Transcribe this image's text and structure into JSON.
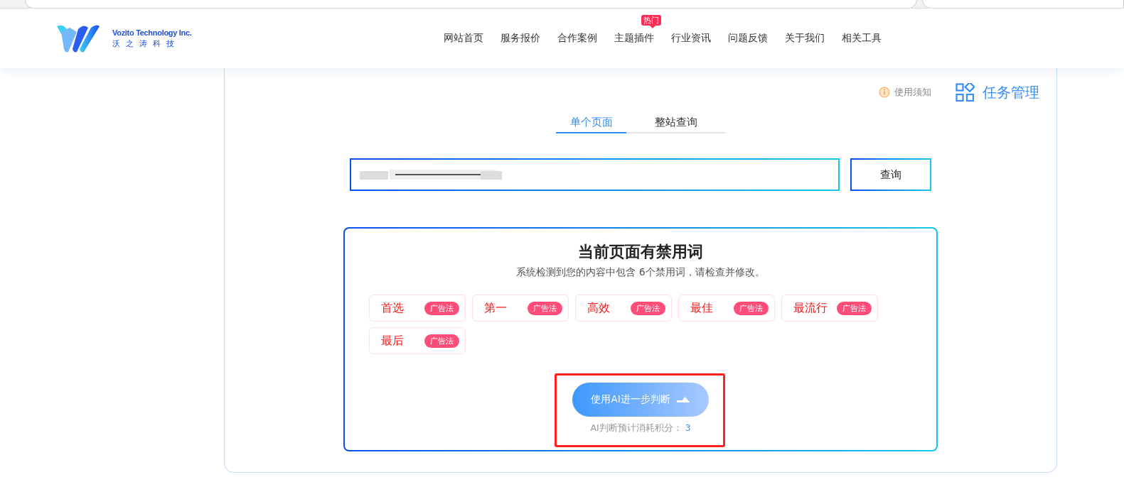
{
  "header": {
    "logo": {
      "name_en": "Vozito Technology Inc.",
      "name_cn": "沃之涛科技"
    },
    "nav": [
      {
        "label": "网站首页"
      },
      {
        "label": "服务报价"
      },
      {
        "label": "合作案例"
      },
      {
        "label": "主题插件",
        "badge": "热门"
      },
      {
        "label": "行业资讯"
      },
      {
        "label": "问题反馈"
      },
      {
        "label": "关于我们"
      },
      {
        "label": "相关工具"
      }
    ]
  },
  "toolbar": {
    "notice": "使用须知",
    "task": "任务管理"
  },
  "tabs": [
    {
      "label": "单个页面",
      "selected": true
    },
    {
      "label": "整站查询",
      "selected": false
    }
  ],
  "search": {
    "button": "查询"
  },
  "result": {
    "title": "当前页面有禁用词",
    "subtitle": "系统检测到您的内容中包含 6个禁用词，请检查并修改。",
    "words": [
      {
        "word": "首选",
        "tag": "广告法"
      },
      {
        "word": "第一",
        "tag": "广告法"
      },
      {
        "word": "高效",
        "tag": "广告法"
      },
      {
        "word": "最佳",
        "tag": "广告法"
      },
      {
        "word": "最流行",
        "tag": "广告法"
      },
      {
        "word": "最后",
        "tag": "广告法"
      }
    ],
    "ai_button": "使用AI进一步判断",
    "cost_label": "AI判断预计消耗积分：",
    "cost_value": "3"
  },
  "annotation": {
    "kind": "frame"
  }
}
